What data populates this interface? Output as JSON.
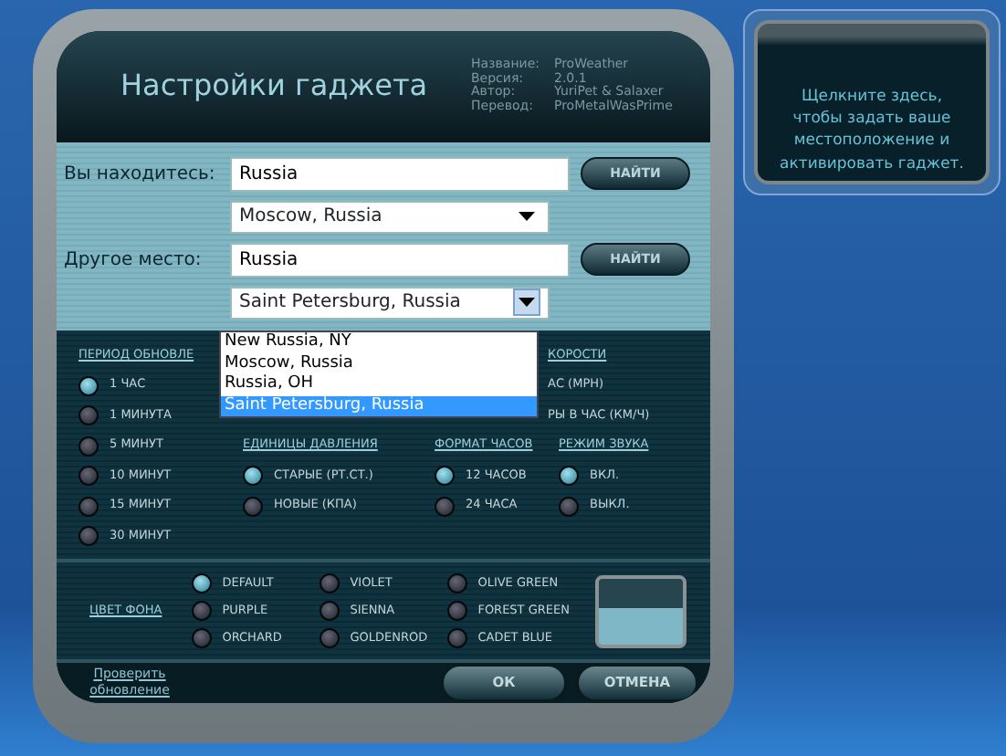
{
  "header": {
    "title": "Настройки гаджета",
    "meta": [
      {
        "label": "Название:",
        "value": "ProWeather"
      },
      {
        "label": "Версия:",
        "value": "2.0.1"
      },
      {
        "label": "Автор:",
        "value": "YuriPet & Salaxer"
      },
      {
        "label": "Перевод:",
        "value": "ProMetalWasPrime"
      }
    ]
  },
  "location": {
    "label": "Вы находитесь:",
    "value": "Russia",
    "button": "НАЙТИ",
    "select": {
      "value": "Moscow, Russia",
      "expanded": false
    }
  },
  "other_place": {
    "label": "Другое место:",
    "value": "Russia",
    "button": "НАЙТИ",
    "select": {
      "value": "Saint Petersburg, Russia",
      "expanded": true,
      "options": [
        {
          "label": "New Russia, NY",
          "selected": false
        },
        {
          "label": "Moscow, Russia",
          "selected": false
        },
        {
          "label": "Russia, OH",
          "selected": false
        },
        {
          "label": "Saint Petersburg, Russia",
          "selected": true
        }
      ]
    }
  },
  "groups": [
    {
      "heading": "ПЕРИОД ОБНОВЛЕ",
      "options": [
        {
          "label": "1 ЧАС",
          "selected": true
        },
        {
          "label": "1 МИНУТА",
          "selected": false
        },
        {
          "label": "5 МИНУТ",
          "selected": false
        },
        {
          "label": "10 МИНУТ",
          "selected": false
        },
        {
          "label": "15 МИНУТ",
          "selected": false
        },
        {
          "label": "30 МИНУТ",
          "selected": false
        }
      ]
    },
    {
      "heading": "КОРОСТИ",
      "options": [
        {
          "label": "АС (MPH)"
        },
        {
          "label": "РЫ В ЧАС (КМ/Ч)"
        }
      ]
    },
    {
      "heading": "ЕДИНИЦЫ ДАВЛЕНИЯ",
      "options": [
        {
          "label": "СТАРЫЕ (РТ.СТ.)",
          "selected": true
        },
        {
          "label": "НОВЫЕ (КПА)",
          "selected": false
        }
      ]
    },
    {
      "heading": "ФОРМАТ ЧАСОВ",
      "options": [
        {
          "label": "12 ЧАСОВ",
          "selected": true
        },
        {
          "label": "24 ЧАСА",
          "selected": false
        }
      ]
    },
    {
      "heading": "РЕЖИМ ЗВУКА",
      "options": [
        {
          "label": "ВКЛ.",
          "selected": true
        },
        {
          "label": "ВЫКЛ.",
          "selected": false
        }
      ]
    }
  ],
  "background_color": {
    "heading": "ЦВЕТ ФОНА",
    "options": [
      {
        "label": "DEFAULT",
        "selected": true
      },
      {
        "label": "PURPLE",
        "selected": false
      },
      {
        "label": "ORCHARD",
        "selected": false
      },
      {
        "label": "VIOLET",
        "selected": false
      },
      {
        "label": "SIENNA",
        "selected": false
      },
      {
        "label": "GOLDENROD",
        "selected": false
      },
      {
        "label": "OLIVE GREEN",
        "selected": false
      },
      {
        "label": "FOREST GREEN",
        "selected": false
      },
      {
        "label": "CADET BLUE",
        "selected": false
      }
    ]
  },
  "update_link": "Проверить обновление",
  "buttons": [
    "ОК",
    "ОТМЕНА"
  ],
  "hint_panel": {
    "text": "Щелкните здесь, чтобы задать ваше местоположение и активировать гаджет."
  }
}
